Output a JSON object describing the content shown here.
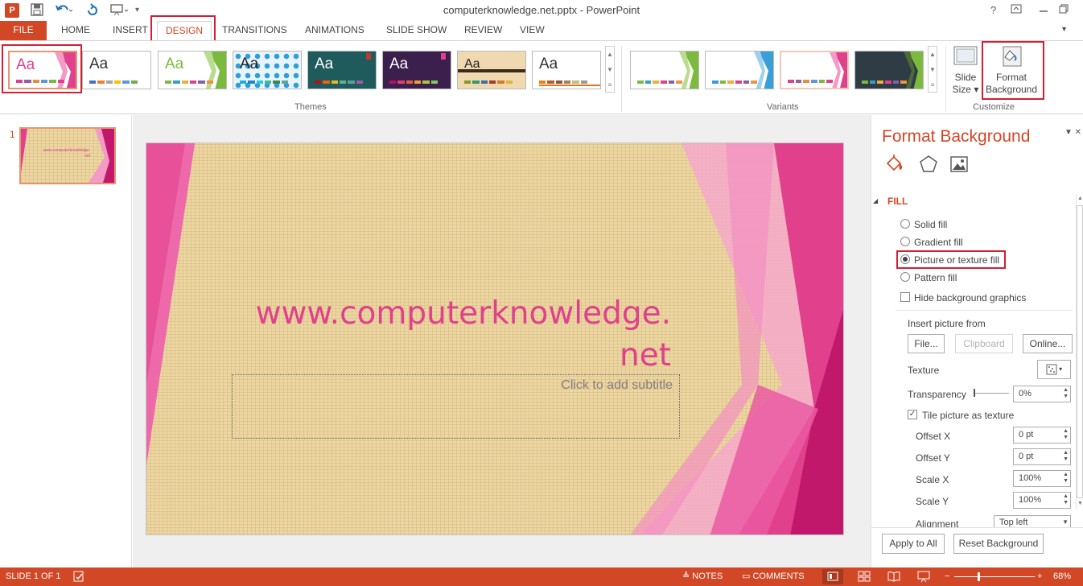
{
  "window": {
    "title": "computerknowledge.net.pptx - PowerPoint",
    "app_badge": "P",
    "help": "?",
    "controls": [
      "restore-ribbon",
      "minimize",
      "maximize"
    ]
  },
  "tabs": [
    "FILE",
    "HOME",
    "INSERT",
    "DESIGN",
    "TRANSITIONS",
    "ANIMATIONS",
    "SLIDE SHOW",
    "REVIEW",
    "VIEW"
  ],
  "ribbon": {
    "themes_label": "Themes",
    "variants_label": "Variants",
    "customize_label": "Customize",
    "theme_sample": "Aa",
    "slide_size_label": "Slide Size",
    "slide_size_line1": "Slide",
    "slide_size_line2": "Size",
    "format_bg_line1": "Format",
    "format_bg_line2": "Background"
  },
  "thumbnails": {
    "slide_number": "1",
    "thumb_text_line1": "www.computerknowledge.",
    "thumb_text_line2": "net"
  },
  "slide": {
    "title_line1": "www.computerknowledge.",
    "title_line2": "net",
    "subtitle_placeholder": "Click to add subtitle"
  },
  "format_pane": {
    "title": "Format Background",
    "section": "FILL",
    "options": {
      "solid": "Solid fill",
      "gradient": "Gradient fill",
      "picture": "Picture or texture fill",
      "pattern": "Pattern fill"
    },
    "selected_option": "Picture or texture fill",
    "hide_bg": "Hide background graphics",
    "insert_from": "Insert picture from",
    "file_btn": "File...",
    "clipboard_btn": "Clipboard",
    "online_btn": "Online...",
    "texture_label": "Texture",
    "transparency_label": "Transparency",
    "transparency_value": "0%",
    "tile_label": "Tile picture as texture",
    "tile_checked": true,
    "offset_x_label": "Offset X",
    "offset_x_value": "0 pt",
    "offset_y_label": "Offset Y",
    "offset_y_value": "0 pt",
    "scale_x_label": "Scale X",
    "scale_x_value": "100%",
    "scale_y_label": "Scale Y",
    "scale_y_value": "100%",
    "alignment_label": "Alignment",
    "alignment_value": "Top left",
    "apply_all": "Apply to All",
    "reset_bg": "Reset Background"
  },
  "status": {
    "slide_info": "SLIDE 1 OF 1",
    "notes": "NOTES",
    "comments": "COMMENTS",
    "zoom": "68%"
  },
  "colors": {
    "accent": "#d24726",
    "slide_pink": "#e0408c",
    "texture": "#ecd6a2",
    "highlight_box": "#d21f35"
  }
}
